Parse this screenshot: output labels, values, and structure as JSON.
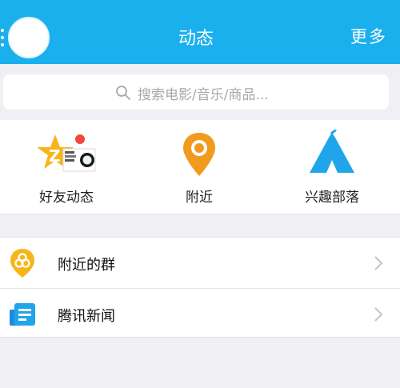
{
  "header": {
    "title": "动态",
    "more_label": "更多"
  },
  "search": {
    "placeholder": "搜索电影/音乐/商品..."
  },
  "features": [
    {
      "label": "好友动态",
      "icon": "friends-feed-icon"
    },
    {
      "label": "附近",
      "icon": "location-pin-icon"
    },
    {
      "label": "兴趣部落",
      "icon": "tent-icon"
    }
  ],
  "list": [
    {
      "label": "附近的群",
      "icon": "nearby-group-icon"
    },
    {
      "label": "腾讯新闻",
      "icon": "news-icon"
    }
  ],
  "colors": {
    "header": "#1ab0ee",
    "accent_orange": "#f29a1e",
    "tribe_blue": "#21a5ea",
    "badge_red": "#f0493d"
  }
}
